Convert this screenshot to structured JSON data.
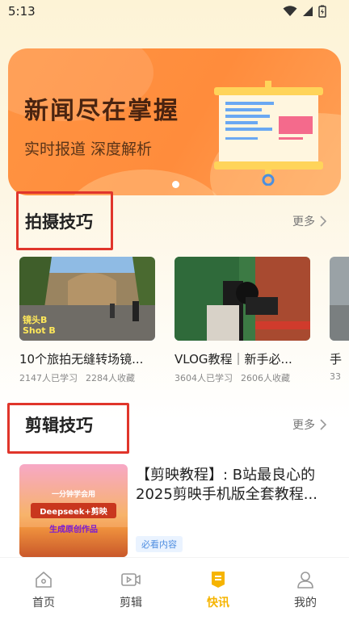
{
  "status_bar": {
    "time": "5:13"
  },
  "banner": {
    "title": "新闻尽在掌握",
    "subtitle": "实时报道 深度解析",
    "colors": {
      "background": "#ff8c3c",
      "title": "#4a2410"
    }
  },
  "shooting": {
    "title": "拍摄技巧",
    "more": "更多",
    "cards": [
      {
        "title": "10个旅拍无缝转场镜...",
        "learners": "2147人已学习",
        "favorites": "2284人收藏",
        "overlay": [
          "镜头B",
          "Shot B"
        ]
      },
      {
        "title": "VLOG教程｜新手必...",
        "learners": "3604人已学习",
        "favorites": "2606人收藏"
      },
      {
        "title": "手",
        "learners": "33",
        "favorites": ""
      }
    ]
  },
  "editing": {
    "title": "剪辑技巧",
    "more": "更多",
    "card": {
      "title": "【剪映教程】: B站最良心的2025剪映手机版全套教程...",
      "tag": "必看内容",
      "thumb_lines": [
        "一分钟学会用",
        "Deepseek+剪映",
        "生成原创作品"
      ]
    }
  },
  "nav": [
    {
      "label": "首页",
      "icon": "home-icon"
    },
    {
      "label": "剪辑",
      "icon": "video-icon"
    },
    {
      "label": "快讯",
      "icon": "news-icon",
      "active": true
    },
    {
      "label": "我的",
      "icon": "user-icon"
    }
  ],
  "colors": {
    "accent": "#f6b400",
    "highlight_box": "#e0352b",
    "tag": "#4f8ee0"
  }
}
